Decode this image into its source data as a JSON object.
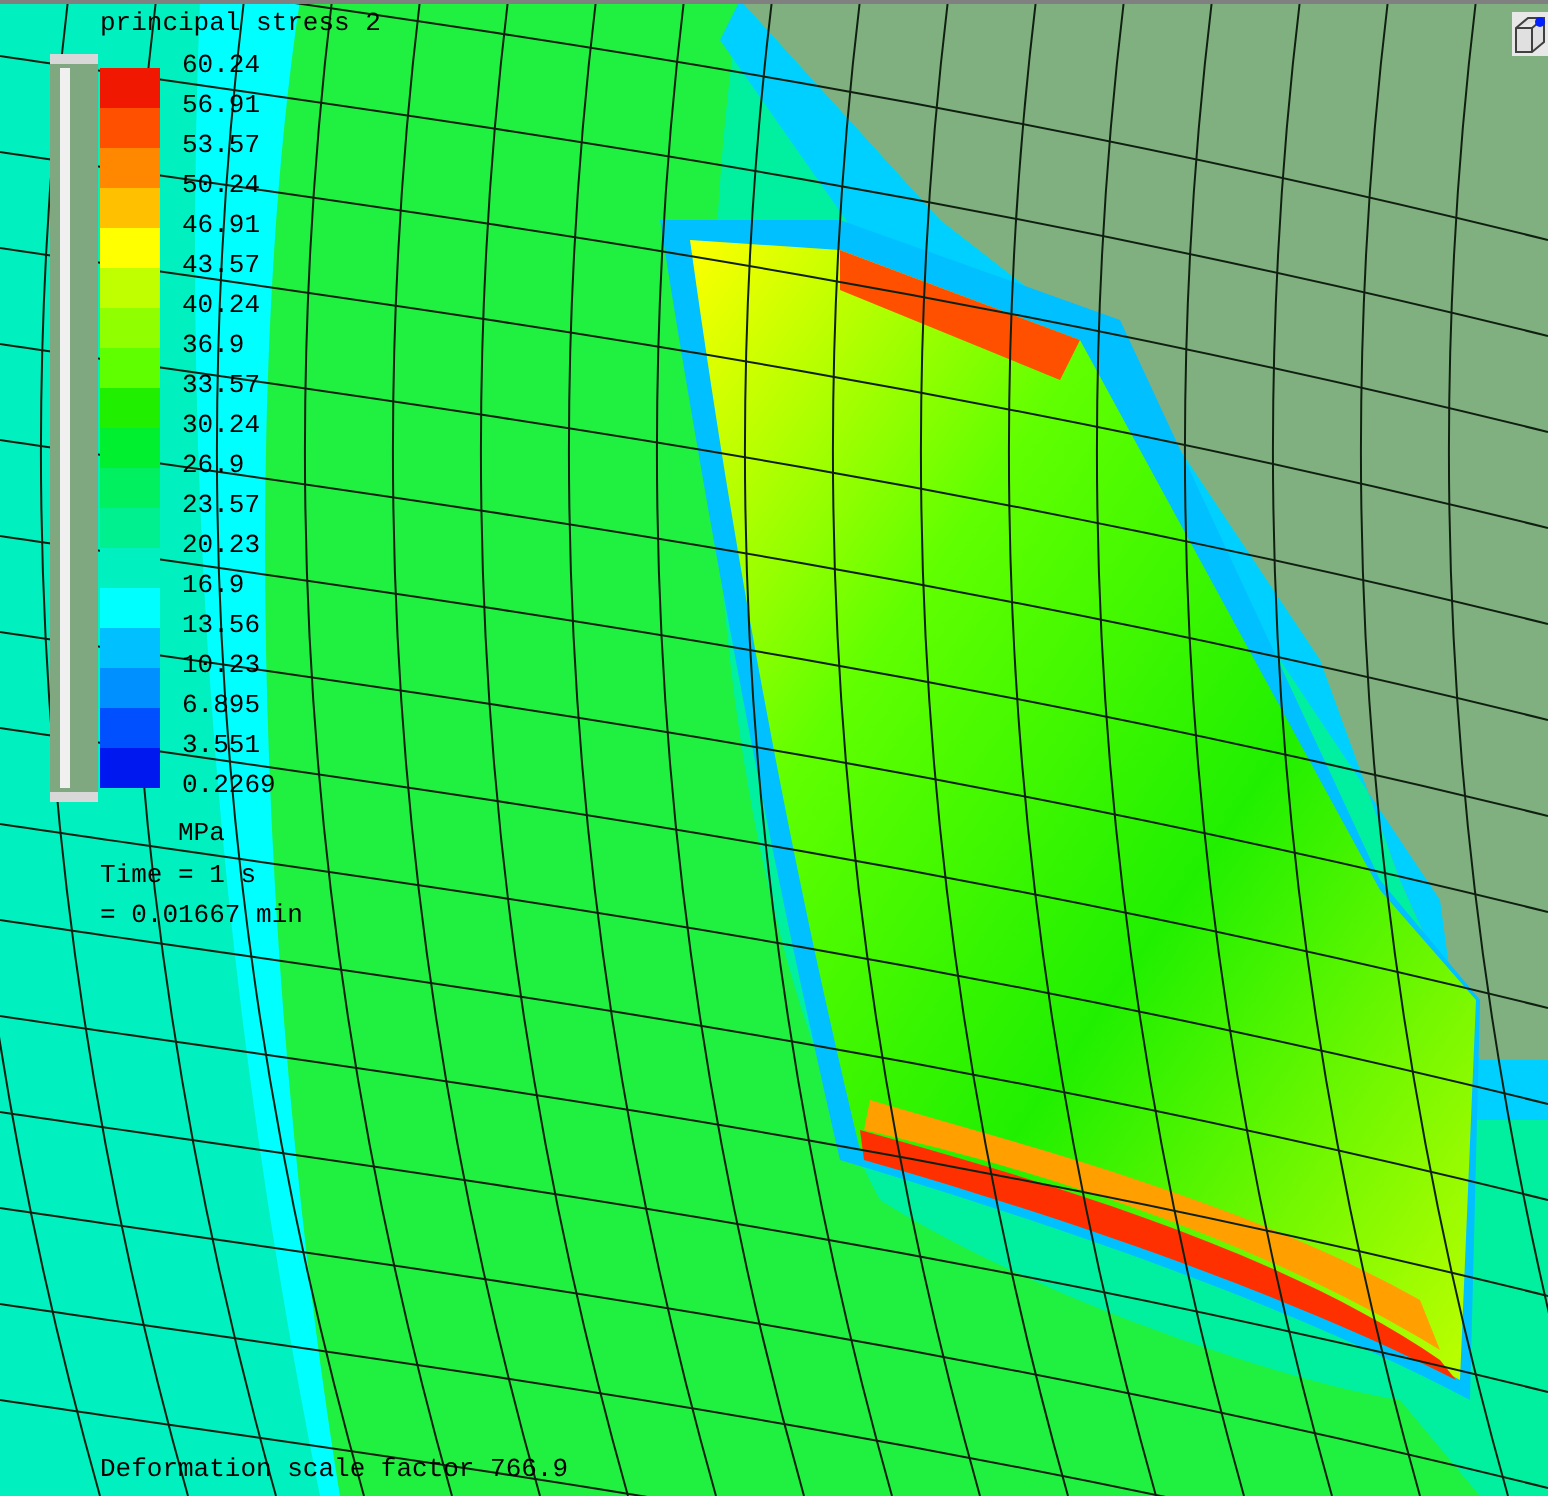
{
  "plot": {
    "title": "principal stress 2",
    "legend": [
      {
        "label": "60.24",
        "color": "#f01800"
      },
      {
        "label": "56.91",
        "color": "#ff5000"
      },
      {
        "label": "53.57",
        "color": "#ff8800"
      },
      {
        "label": "50.24",
        "color": "#ffc000"
      },
      {
        "label": "46.91",
        "color": "#ffff00"
      },
      {
        "label": "43.57",
        "color": "#c0ff00"
      },
      {
        "label": "40.24",
        "color": "#90ff00"
      },
      {
        "label": "36.9",
        "color": "#60ff00"
      },
      {
        "label": "33.57",
        "color": "#20f000"
      },
      {
        "label": "30.24",
        "color": "#00f030"
      },
      {
        "label": "26.9",
        "color": "#00f060"
      },
      {
        "label": "23.57",
        "color": "#00f090"
      },
      {
        "label": "20.23",
        "color": "#00f0c0"
      },
      {
        "label": "16.9",
        "color": "#00ffff"
      },
      {
        "label": "13.56",
        "color": "#00c0ff"
      },
      {
        "label": "10.23",
        "color": "#0090ff"
      },
      {
        "label": "6.895",
        "color": "#0050ff"
      },
      {
        "label": "3.551",
        "color": "#0018f0"
      }
    ],
    "end_label": "0.2269",
    "unit": "MPa",
    "time": "Time = 1 s",
    "time_minutes": "= 0.01667 min",
    "footer": "Deformation scale factor 766.9"
  }
}
